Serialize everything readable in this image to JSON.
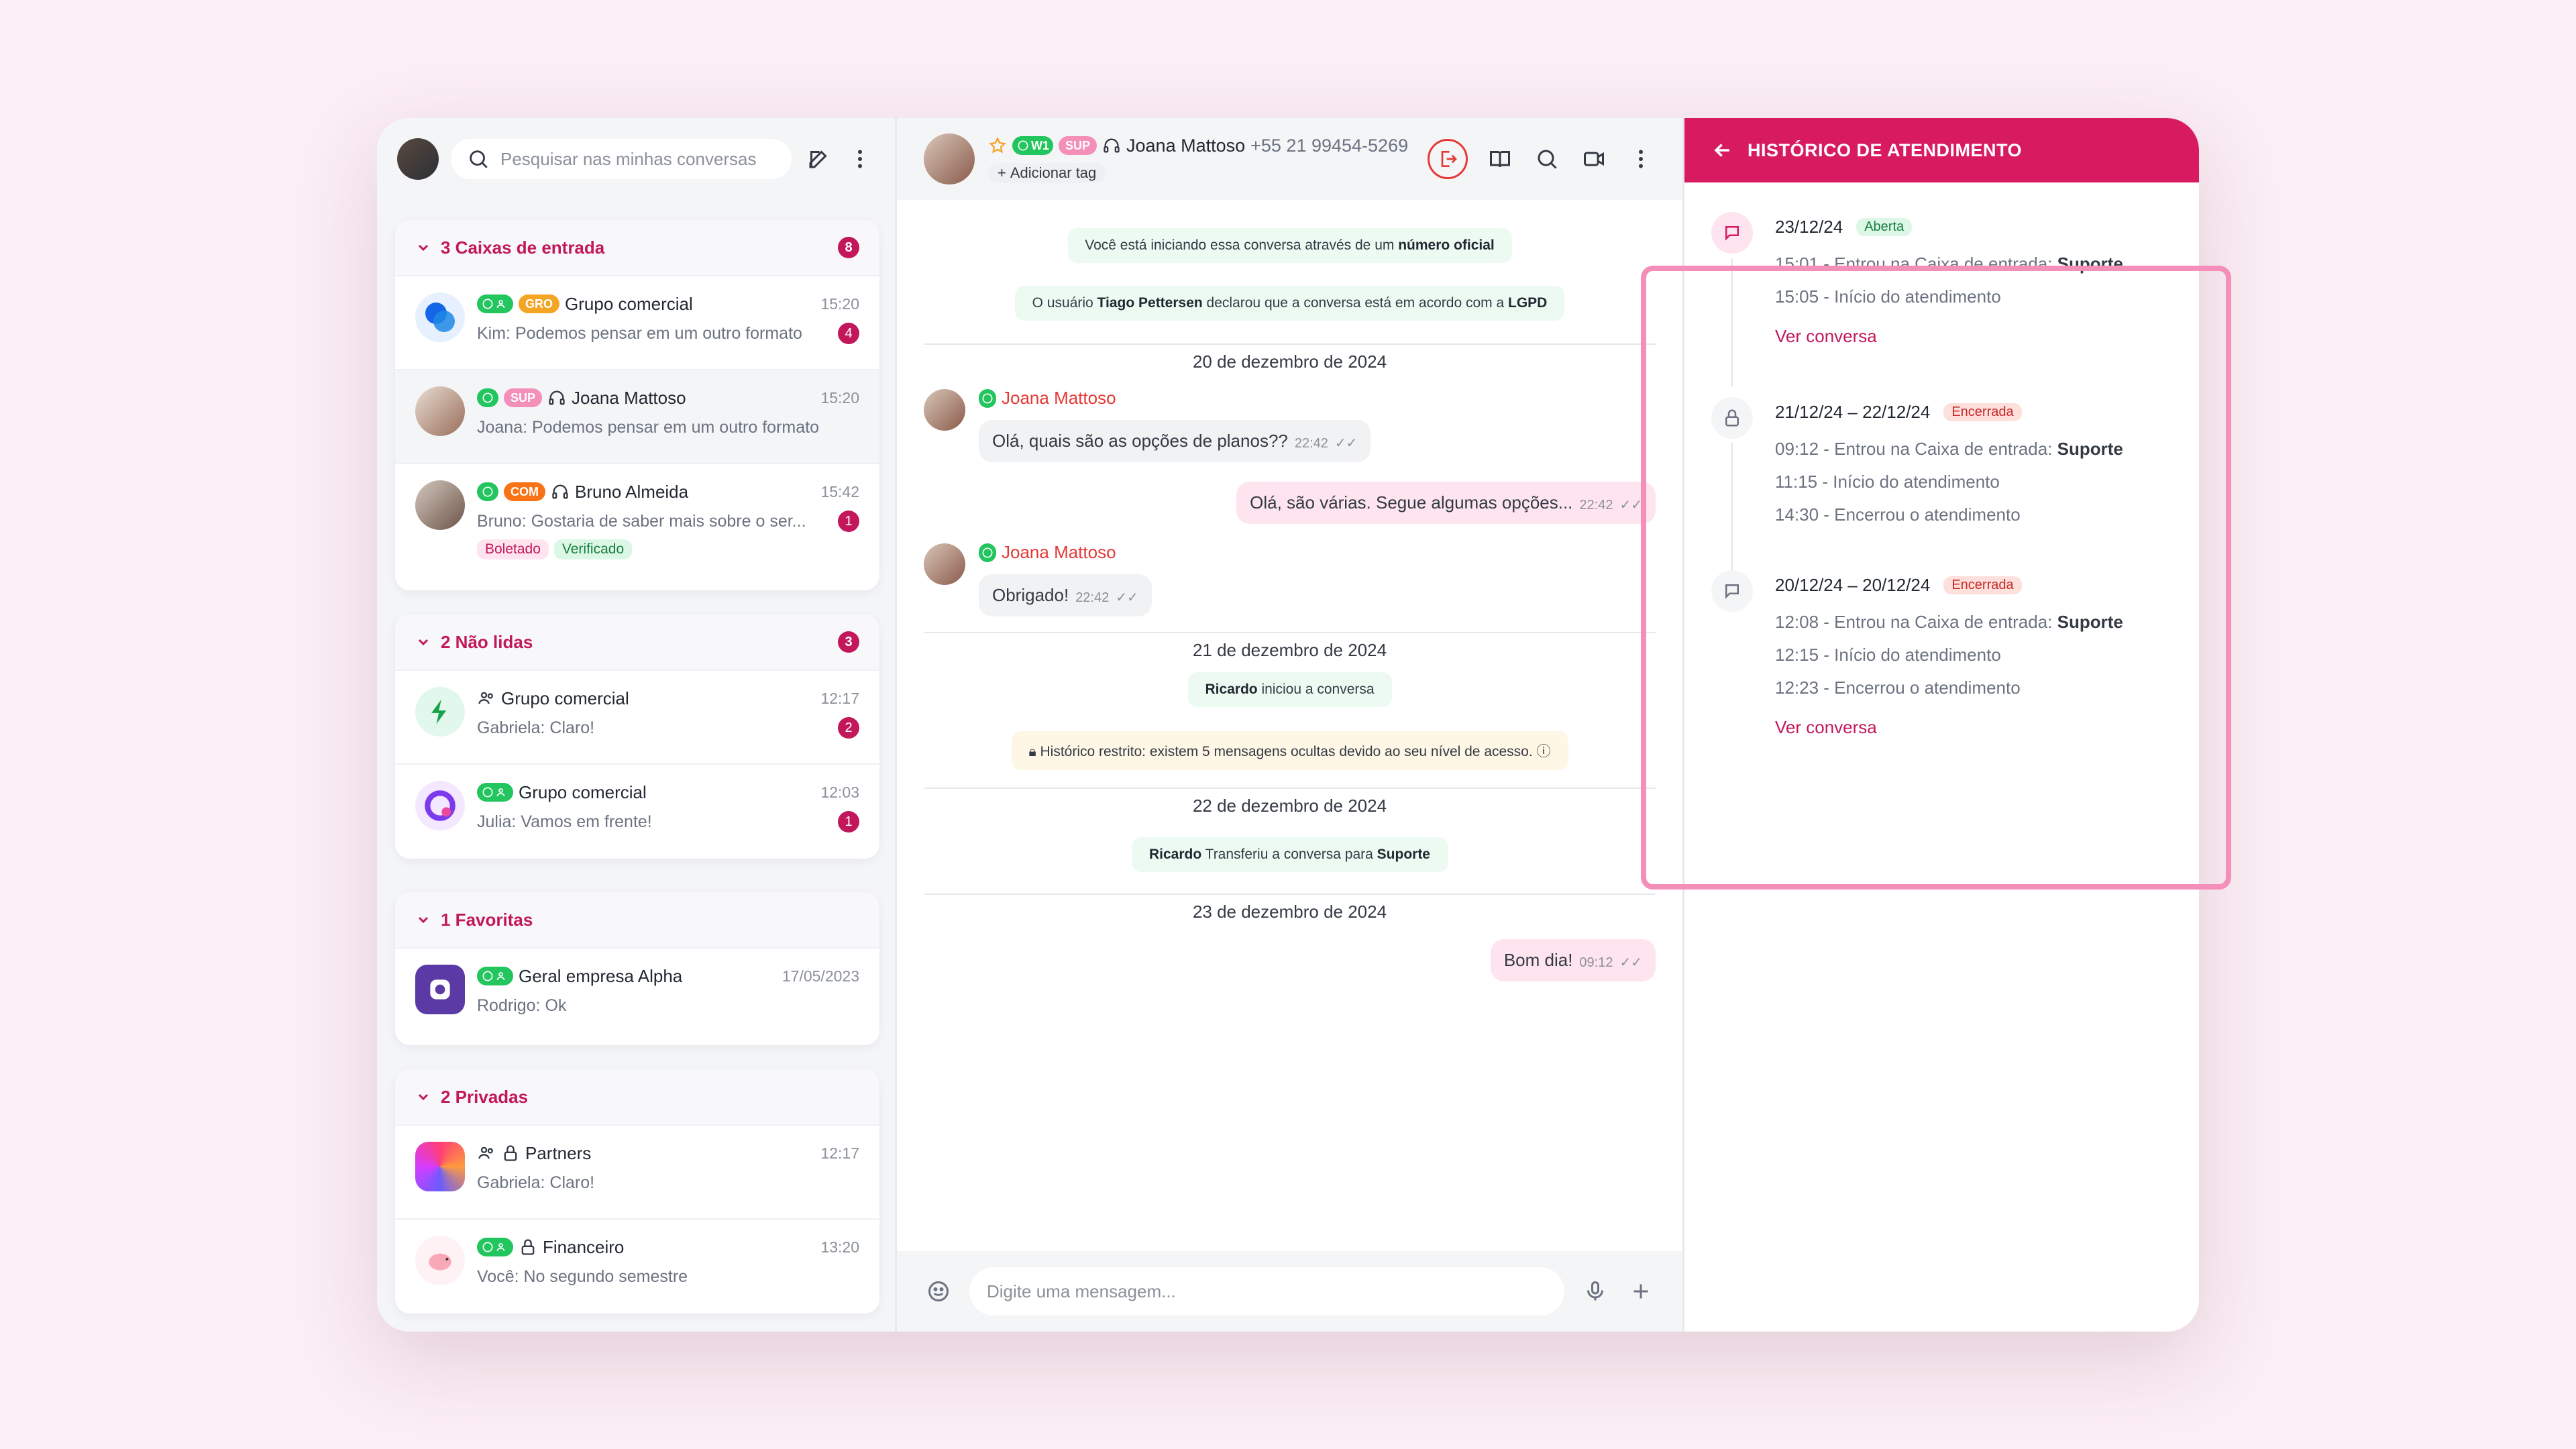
{
  "search": {
    "placeholder": "Pesquisar nas minhas conversas"
  },
  "sections": [
    {
      "title": "3 Caixas de entrada",
      "count": "8",
      "items": [
        {
          "name": "Grupo comercial",
          "tag": "GRO",
          "time": "15:20",
          "preview": "Kim: Podemos pensar em um outro formato",
          "badge": "4"
        },
        {
          "name": "Joana Mattoso",
          "tag": "SUP",
          "time": "15:20",
          "preview": "Joana: Podemos pensar em um outro formato",
          "badge": ""
        },
        {
          "name": "Bruno Almeida",
          "tag": "COM",
          "time": "15:42",
          "preview": "Bruno: Gostaria de saber mais sobre o ser...",
          "badge": "1",
          "chips": [
            "Boletado",
            "Verificado"
          ]
        }
      ]
    },
    {
      "title": "2 Não lidas",
      "count": "3",
      "items": [
        {
          "name": "Grupo comercial",
          "time": "12:17",
          "preview": "Gabriela: Claro!",
          "badge": "2"
        },
        {
          "name": "Grupo comercial",
          "time": "12:03",
          "preview": "Julia: Vamos em frente!",
          "badge": "1"
        }
      ]
    },
    {
      "title": "1 Favoritas",
      "count": "",
      "items": [
        {
          "name": "Geral empresa Alpha",
          "time": "17/05/2023",
          "preview": "Rodrigo: Ok",
          "badge": ""
        }
      ]
    },
    {
      "title": "2 Privadas",
      "count": "",
      "items": [
        {
          "name": "Partners",
          "time": "12:17",
          "preview": "Gabriela: Claro!",
          "badge": ""
        },
        {
          "name": "Financeiro",
          "time": "13:20",
          "preview": "Você: No segundo semestre",
          "badge": ""
        }
      ]
    }
  ],
  "chat": {
    "contact": "Joana Mattoso",
    "phone": "+55 21 99454-5269",
    "wa_label": "W1",
    "tag": "SUP",
    "add_tag": "Adicionar tag",
    "sys1_pre": "Você está iniciando essa conversa através de um ",
    "sys1_bold": "número oficial",
    "sys2_pre": "O usuário ",
    "sys2_user": "Tiago Pettersen",
    "sys2_mid": " declarou que a conversa está em acordo com a ",
    "sys2_bold": "LGPD",
    "date1": "20 de dezembro de 2024",
    "sender": "Joana Mattoso",
    "m1": "Olá, quais são as opções de planos??",
    "m1t": "22:42",
    "m2": "Olá, são várias. Segue algumas opções...",
    "m2t": "22:42",
    "m3": "Obrigado!",
    "m3t": "22:42",
    "date2": "21 de dezembro de 2024",
    "sys3_bold": "Ricardo",
    "sys3_rest": " iniciou a conversa",
    "sys4": "Histórico restrito: existem 5 mensagens ocultas devido ao seu nível de acesso.",
    "date3": "22 de dezembro de 2024",
    "sys5_bold": "Ricardo",
    "sys5_mid": " Transferiu a conversa para ",
    "sys5_bold2": "Suporte",
    "date4": "23 de dezembro de 2024",
    "m4": "Bom dia!",
    "m4t": "09:12",
    "composer_placeholder": "Digite uma mensagem..."
  },
  "history": {
    "title": "HISTÓRICO DE ATENDIMENTO",
    "entries": [
      {
        "date": "23/12/24",
        "status": "Aberta",
        "e1": "15:01 - Entrou na Caixa de entrada: ",
        "e1b": "Suporte",
        "e2": "15:05 - Início do atendimento",
        "link": "Ver conversa"
      },
      {
        "date": "21/12/24 – 22/12/24",
        "status": "Encerrada",
        "e1": "09:12 - Entrou na Caixa de entrada: ",
        "e1b": "Suporte",
        "e2": "11:15 - Início do atendimento",
        "e3": "14:30 - Encerrou o atendimento"
      },
      {
        "date": "20/12/24 – 20/12/24",
        "status": "Encerrada",
        "e1": "12:08 - Entrou na Caixa de entrada: ",
        "e1b": "Suporte",
        "e2": "12:15 - Início do atendimento",
        "e3": "12:23 - Encerrou o atendimento",
        "link": "Ver conversa"
      }
    ]
  },
  "colors": {
    "brand": "#d81b60",
    "whatsapp": "#22c55e",
    "gro": "#f5a524",
    "sup": "#f48fb9",
    "com": "#f97316"
  }
}
